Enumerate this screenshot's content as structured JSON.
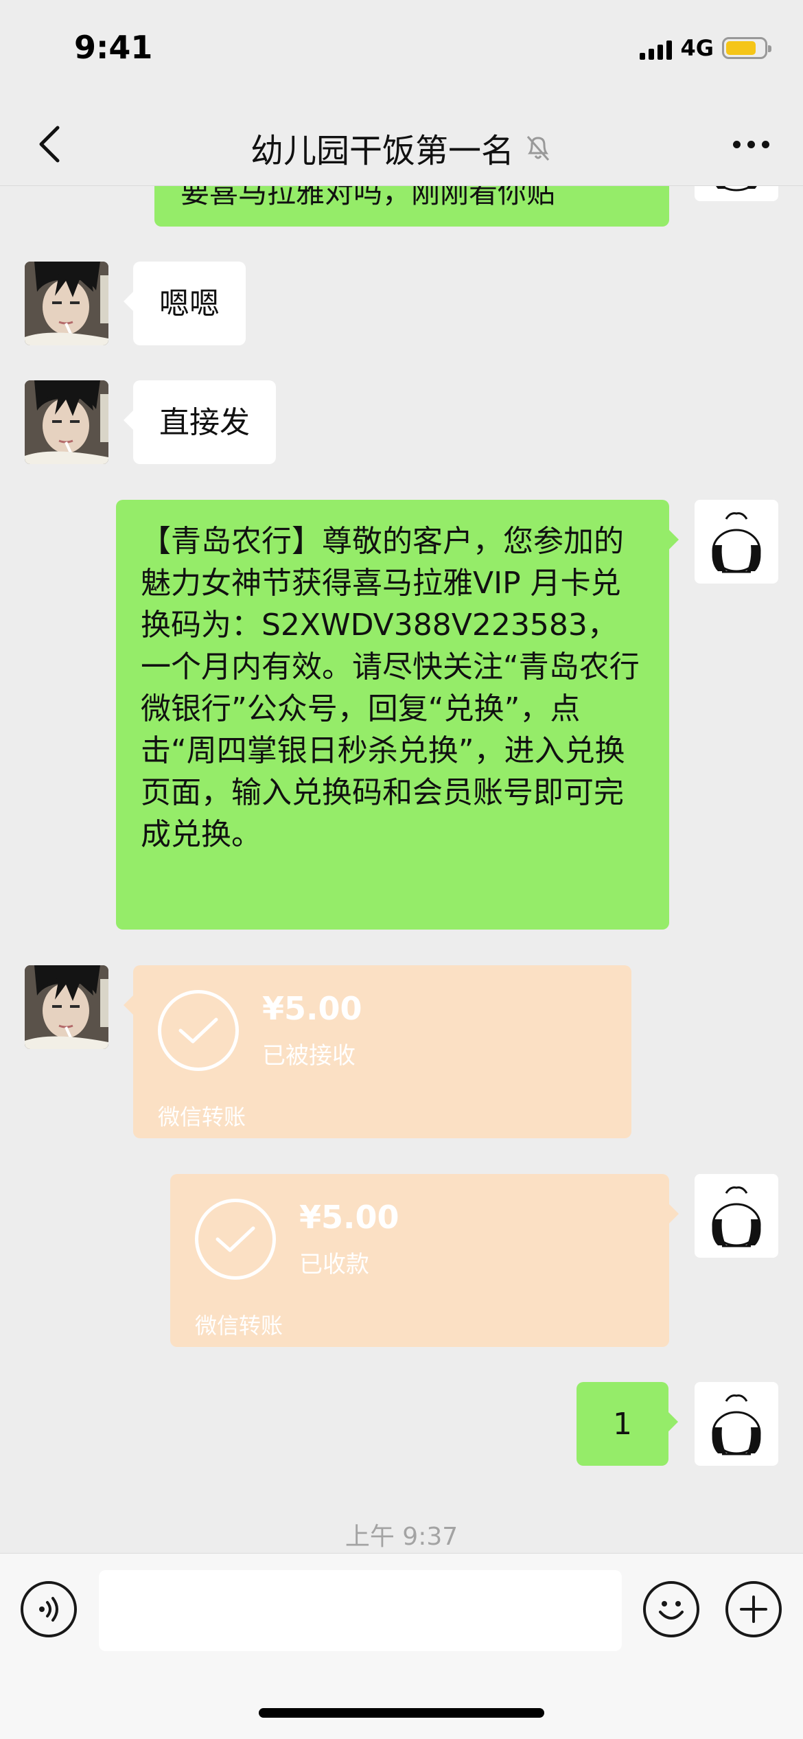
{
  "status_bar": {
    "time": "9:41",
    "network": "4G",
    "battery_color": "#f5c518"
  },
  "header": {
    "title": "幼儿园干饭第一名",
    "back_icon": "chevron-left-icon",
    "mute_icon": "muted-bell-icon",
    "more_icon": "more-dots-icon"
  },
  "colors": {
    "background": "#ededed",
    "outgoing_bubble": "#95ec69",
    "incoming_bubble": "#ffffff",
    "transfer_card": "#fbe0c4"
  },
  "messages": {
    "m0": {
      "direction": "outgoing",
      "type": "text",
      "text": "要喜马拉雅对吗，刚刚看你贴"
    },
    "m1": {
      "direction": "incoming",
      "type": "text",
      "text": "嗯嗯"
    },
    "m2": {
      "direction": "incoming",
      "type": "text",
      "text": "直接发"
    },
    "m3": {
      "direction": "outgoing",
      "type": "text",
      "text": "【青岛农行】尊敬的客户，您参加的魅力女神节获得喜马拉雅VIP 月卡兑换码为：S2XWDV388V223583，一个月内有效。请尽快关注“青岛农行微银行”公众号，回复“兑换”，点击“周四掌银日秒杀兑换”，进入兑换页面，输入兑换码和会员账号即可完成兑换。"
    },
    "m4": {
      "direction": "incoming",
      "type": "transfer",
      "amount": "¥5.00",
      "status": "已被接收",
      "footer": "微信转账"
    },
    "m5": {
      "direction": "outgoing",
      "type": "transfer",
      "amount": "¥5.00",
      "status": "已收款",
      "footer": "微信转账"
    },
    "m6": {
      "direction": "outgoing",
      "type": "text",
      "text": "1"
    }
  },
  "timestamp": "上午 9:37",
  "input_bar": {
    "placeholder": "",
    "voice_icon": "voice-icon",
    "emoji_icon": "emoji-icon",
    "plus_icon": "plus-icon"
  }
}
